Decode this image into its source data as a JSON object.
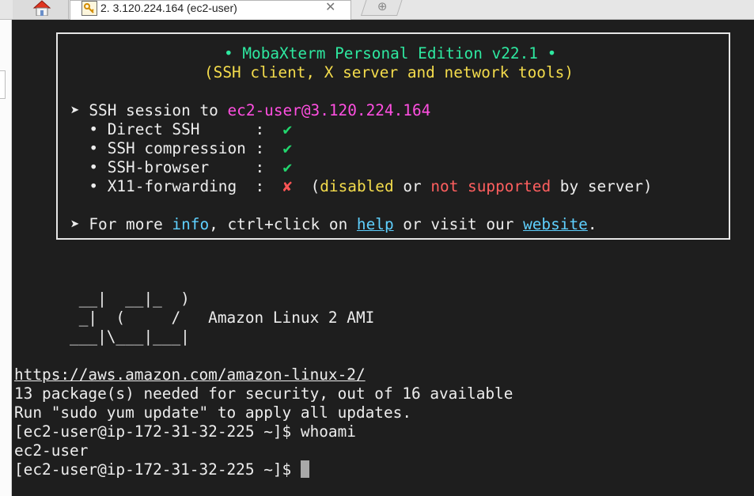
{
  "tab": {
    "number": "2.",
    "title": "3.120.224.164 (ec2-user)",
    "close_glyph": "✕",
    "new_tab_glyph": "⊕"
  },
  "banner": {
    "title": "• MobaXterm Personal Edition v22.1 •",
    "subtitle": "(SSH client, X server and network tools)",
    "session_prefix": "➤ SSH session to ",
    "session_target": "ec2-user@3.120.224.164",
    "features": [
      {
        "label": "• Direct SSH      :  ",
        "mark": "✔"
      },
      {
        "label": "• SSH compression :  ",
        "mark": "✔"
      },
      {
        "label": "• SSH-browser     :  ",
        "mark": "✔"
      },
      {
        "label": "• X11-forwarding  :  ",
        "mark": "✘"
      }
    ],
    "x11_note": {
      "open": "  (",
      "disabled": "disabled",
      "or": " or ",
      "not_supported": "not supported",
      "close": " by server)"
    },
    "info": {
      "prefix": "➤ For more ",
      "info": "info",
      "mid": ", ctrl+click on ",
      "help": "help",
      "mid2": " or visit our ",
      "website": "website",
      "end": "."
    }
  },
  "ascii_art": [
    "       __|  __|_  )",
    "       _|  (     /   Amazon Linux 2 AMI",
    "      ___|\\___|___|"
  ],
  "output": {
    "url": "https://aws.amazon.com/amazon-linux-2/",
    "packages": "13 package(s) needed for security, out of 16 available",
    "update_hint": "Run \"sudo yum update\" to apply all updates.",
    "prompt": "[ec2-user@ip-172-31-32-225 ~]$ ",
    "command": "whoami",
    "result": "ec2-user"
  },
  "colors": {
    "terminal_bg": "#1e1e1e",
    "title_green": "#2ee8a0",
    "subtitle_yellow": "#f4dc4c",
    "host_magenta": "#ff4fe1",
    "check_green": "#22d66e",
    "cross_red": "#ff5555",
    "link_cyan": "#5fd0ff"
  }
}
